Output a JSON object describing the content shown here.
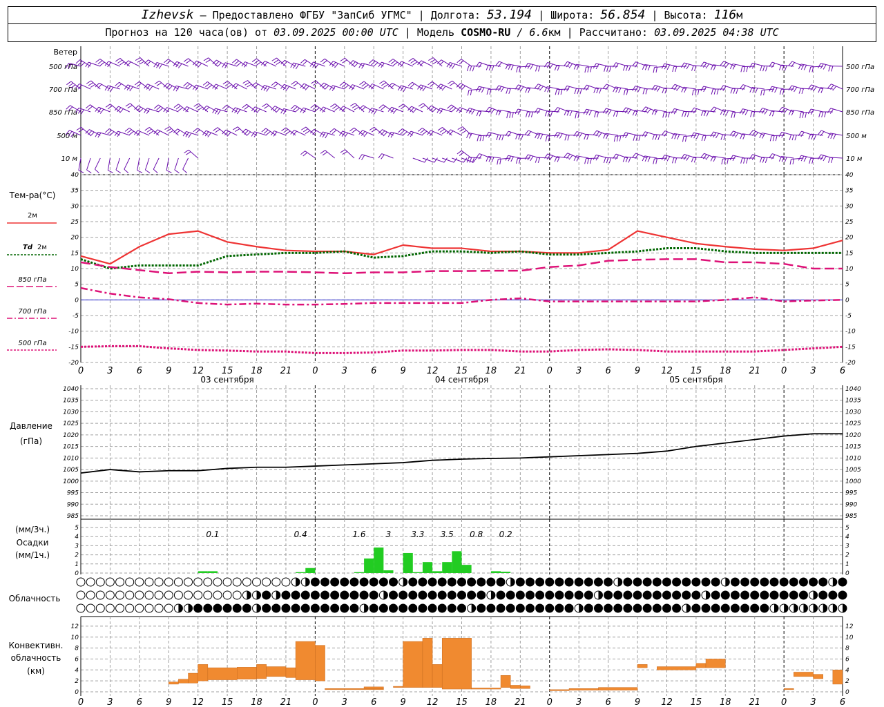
{
  "header": {
    "location": "Izhevsk",
    "provider": "Предоставлено ФГБУ \"ЗапСиб УГМС\"",
    "longitude_label": "Долгота:",
    "longitude": "53.194",
    "latitude_label": "Широта:",
    "latitude": "56.854",
    "altitude_label": "Высота:",
    "altitude": "116",
    "altitude_unit": "м",
    "forecast_prefix": "Прогноз на 120 часа(ов) от",
    "forecast_start": "03.09.2025 00:00 UTC",
    "model_label": "Модель",
    "model": "COSMO-RU",
    "model_res": "/ 6.6",
    "model_res_unit": "км",
    "calc_label": "Рассчитано:",
    "calc_time": "03.09.2025 04:38 UTC"
  },
  "labels": {
    "wind": "Ветер",
    "wind_levels": [
      "500 гПа",
      "700 гПа",
      "850 гПа",
      "500 м",
      "10 м"
    ],
    "temp": "Тем-ра(°C)",
    "t2m": "2м",
    "td": "Td",
    "td2m": "2м",
    "t850": "850 гПа",
    "t700": "700 гПа",
    "t500": "500 гПа",
    "pressure": "Давление",
    "pressure_unit": "(гПа)",
    "precip_unit1": "(мм/3ч.)",
    "precip": "Осадки",
    "precip_unit2": "(мм/1ч.)",
    "cloud": "Облачность",
    "conv1": "Конвективн.",
    "conv2": "облачность",
    "conv3": "(км)"
  },
  "colors": {
    "t2m": "#ee3333",
    "td": "#006600",
    "t850": "#dd1177",
    "t700": "#dd1177",
    "t500": "#dd1177",
    "wind": "#6a0dad",
    "precip": "#22cc22",
    "conv": "#f08a30",
    "pressure": "#000000",
    "grid": "#a0a0a0",
    "zero_line": "#2222cc"
  },
  "chart_data": [
    {
      "type": "line",
      "panel": "temperature",
      "ylabel": "Тем-ра(°C)",
      "ylim": [
        -20,
        40
      ],
      "yticks": [
        40,
        35,
        30,
        25,
        20,
        15,
        10,
        5,
        0,
        -5,
        -10,
        -15,
        -20
      ],
      "x_hours": [
        0,
        3,
        6,
        9,
        12,
        15,
        18,
        21,
        24,
        27,
        30,
        33,
        36,
        39,
        42,
        45,
        48,
        51,
        54,
        57,
        60,
        63,
        66,
        69,
        72,
        75,
        78
      ],
      "x_tick_labels": [
        "0",
        "3",
        "6",
        "9",
        "12",
        "15",
        "18",
        "21",
        "0",
        "3",
        "6",
        "9",
        "12",
        "15",
        "18",
        "21",
        "0",
        "3",
        "6",
        "9",
        "12",
        "15",
        "18",
        "21",
        "0",
        "3",
        "6"
      ],
      "date_labels": [
        {
          "hour": 15,
          "label": "03 сентября"
        },
        {
          "hour": 39,
          "label": "04 сентября"
        },
        {
          "hour": 63,
          "label": "05 сентября"
        }
      ],
      "series": [
        {
          "name": "2м",
          "style": "solid",
          "values": [
            14,
            11.5,
            17,
            21,
            22,
            18.5,
            17,
            15.8,
            15.5,
            15.5,
            14.5,
            17.5,
            16.5,
            16.5,
            15.5,
            15.5,
            15,
            15,
            16,
            22,
            20,
            18,
            17,
            16.2,
            15.8,
            16.5,
            19
          ]
        },
        {
          "name": "Td 2м",
          "style": "dotted",
          "values": [
            13,
            10,
            11,
            11,
            11,
            14,
            14.5,
            15,
            15,
            15.5,
            13.5,
            14,
            15.5,
            15.5,
            15,
            15.5,
            14.5,
            14.5,
            15,
            15.5,
            16.5,
            16.5,
            15.5,
            15,
            15,
            15,
            15
          ]
        },
        {
          "name": "850 гПа",
          "style": "longdash",
          "values": [
            12,
            10.5,
            9.5,
            8.5,
            9,
            8.8,
            9,
            9,
            8.8,
            8.5,
            8.8,
            8.8,
            9.2,
            9.2,
            9.3,
            9.3,
            10.5,
            11,
            12.5,
            12.8,
            13,
            13,
            12,
            12,
            11.5,
            10,
            10
          ]
        },
        {
          "name": "700 гПа",
          "style": "dashdot",
          "values": [
            3.8,
            2,
            0.8,
            0.2,
            -1,
            -1.5,
            -1.2,
            -1.5,
            -1.5,
            -1.3,
            -1,
            -1,
            -1,
            -1,
            0,
            0.5,
            -0.5,
            -0.5,
            -0.5,
            -0.5,
            -0.5,
            -0.5,
            0,
            0.8,
            -0.5,
            -0.2,
            0
          ]
        },
        {
          "name": "500 гПа",
          "style": "dotted",
          "values": [
            -15,
            -14.8,
            -14.8,
            -15.5,
            -16,
            -16.2,
            -16.5,
            -16.5,
            -17,
            -17,
            -16.8,
            -16.2,
            -16.2,
            -16,
            -16,
            -16.5,
            -16.5,
            -16,
            -15.8,
            -16,
            -16.5,
            -16.5,
            -16.5,
            -16.5,
            -16,
            -15.5,
            -15
          ]
        }
      ]
    },
    {
      "type": "line",
      "panel": "pressure",
      "ylabel": "Давление (гПа)",
      "ylim": [
        985,
        1040
      ],
      "yticks": [
        1040,
        1035,
        1030,
        1025,
        1020,
        1015,
        1010,
        1005,
        1000,
        995,
        990,
        985
      ],
      "series": [
        {
          "name": "Давление",
          "values": [
            1003.5,
            1005,
            1004,
            1004.5,
            1004.5,
            1005.5,
            1006,
            1006,
            1006.5,
            1007,
            1007.5,
            1008,
            1009,
            1009.5,
            1009.8,
            1010,
            1010.5,
            1011,
            1011.5,
            1012,
            1013,
            1015,
            1016.5,
            1018,
            1019.5,
            1020.5,
            1020.5
          ]
        }
      ]
    },
    {
      "type": "bar",
      "panel": "precipitation",
      "ylabel": "Осадки (мм/1ч.)",
      "ylim": [
        0,
        5
      ],
      "yticks": [
        5,
        4,
        3,
        2,
        1,
        0
      ],
      "bars": [
        {
          "hour": 12,
          "value": 0.2
        },
        {
          "hour": 13,
          "value": 0.2
        },
        {
          "hour": 22,
          "value": 0.1
        },
        {
          "hour": 23,
          "value": 0.55
        },
        {
          "hour": 28,
          "value": 0.1
        },
        {
          "hour": 29,
          "value": 1.6
        },
        {
          "hour": 30,
          "value": 2.8
        },
        {
          "hour": 31,
          "value": 0.3
        },
        {
          "hour": 33,
          "value": 2.2
        },
        {
          "hour": 34,
          "value": 0.1
        },
        {
          "hour": 35,
          "value": 1.2
        },
        {
          "hour": 36,
          "value": 0.2
        },
        {
          "hour": 37,
          "value": 1.2
        },
        {
          "hour": 38,
          "value": 2.4
        },
        {
          "hour": 39,
          "value": 0.9
        },
        {
          "hour": 42,
          "value": 0.2
        },
        {
          "hour": 43,
          "value": 0.15
        }
      ],
      "totals_3h": [
        {
          "hour": 13.5,
          "label": "0.1"
        },
        {
          "hour": 22.5,
          "label": "0.4"
        },
        {
          "hour": 28.5,
          "label": "1.6"
        },
        {
          "hour": 31.5,
          "label": "3"
        },
        {
          "hour": 34.5,
          "label": "3.3"
        },
        {
          "hour": 37.5,
          "label": "3.5"
        },
        {
          "hour": 40.5,
          "label": "0.8"
        },
        {
          "hour": 43.5,
          "label": "0.2"
        }
      ]
    },
    {
      "type": "bar",
      "panel": "convective_cloud",
      "ylabel": "Конвективн. облачность (км)",
      "ylim": [
        0,
        13
      ],
      "yticks": [
        12,
        10,
        8,
        6,
        4,
        2,
        0
      ],
      "ranges": [
        {
          "h0": 9,
          "h1": 10,
          "base": 1.4,
          "top": 1.8
        },
        {
          "h0": 10,
          "h1": 11,
          "base": 1.6,
          "top": 2.3
        },
        {
          "h0": 11,
          "h1": 12,
          "base": 1.6,
          "top": 3.4
        },
        {
          "h0": 12,
          "h1": 13,
          "base": 2.0,
          "top": 5.0
        },
        {
          "h0": 13,
          "h1": 16,
          "base": 2.2,
          "top": 4.4
        },
        {
          "h0": 16,
          "h1": 18,
          "base": 2.3,
          "top": 4.5
        },
        {
          "h0": 18,
          "h1": 19,
          "base": 2.4,
          "top": 5.0
        },
        {
          "h0": 19,
          "h1": 21,
          "base": 2.8,
          "top": 4.6
        },
        {
          "h0": 21,
          "h1": 22,
          "base": 2.6,
          "top": 4.4
        },
        {
          "h0": 22,
          "h1": 24,
          "base": 2.2,
          "top": 9.2
        },
        {
          "h0": 24,
          "h1": 25,
          "base": 2.0,
          "top": 8.5
        },
        {
          "h0": 25,
          "h1": 31,
          "base": 0.4,
          "top": 0.6
        },
        {
          "h0": 29,
          "h1": 31,
          "base": 0.6,
          "top": 0.9
        },
        {
          "h0": 32,
          "h1": 33,
          "base": 0.8,
          "top": 1.0
        },
        {
          "h0": 33,
          "h1": 35,
          "base": 0.8,
          "top": 9.2
        },
        {
          "h0": 35,
          "h1": 36,
          "base": 0.8,
          "top": 9.8
        },
        {
          "h0": 36,
          "h1": 37,
          "base": 0.8,
          "top": 5.0
        },
        {
          "h0": 37,
          "h1": 40,
          "base": 0.5,
          "top": 9.8
        },
        {
          "h0": 40,
          "h1": 43,
          "base": 0.5,
          "top": 0.7
        },
        {
          "h0": 43,
          "h1": 44,
          "base": 0.8,
          "top": 3.0
        },
        {
          "h0": 44,
          "h1": 45,
          "base": 0.6,
          "top": 1.2
        },
        {
          "h0": 45,
          "h1": 46,
          "base": 0.6,
          "top": 1.1
        },
        {
          "h0": 48,
          "h1": 50,
          "base": 0.2,
          "top": 0.4
        },
        {
          "h0": 50,
          "h1": 53,
          "base": 0.3,
          "top": 0.6
        },
        {
          "h0": 53,
          "h1": 57,
          "base": 0.3,
          "top": 0.8
        },
        {
          "h0": 57,
          "h1": 58,
          "base": 4.4,
          "top": 5.0
        },
        {
          "h0": 59,
          "h1": 63,
          "base": 4.0,
          "top": 4.6
        },
        {
          "h0": 63,
          "h1": 64,
          "base": 4.4,
          "top": 5.2
        },
        {
          "h0": 64,
          "h1": 66,
          "base": 4.4,
          "top": 6.0
        },
        {
          "h0": 72,
          "h1": 73,
          "base": 0.4,
          "top": 0.6
        },
        {
          "h0": 73,
          "h1": 75,
          "base": 2.8,
          "top": 3.6
        },
        {
          "h0": 75,
          "h1": 76,
          "base": 2.4,
          "top": 3.2
        },
        {
          "h0": 77,
          "h1": 78,
          "base": 1.4,
          "top": 4.0
        }
      ]
    }
  ]
}
